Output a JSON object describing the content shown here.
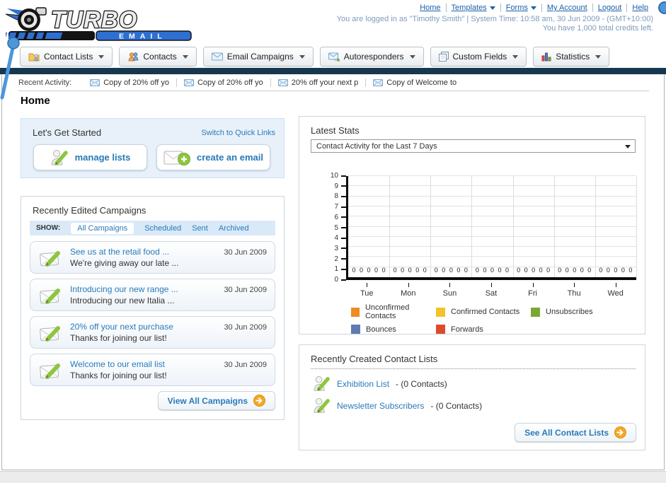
{
  "colors": {
    "accent_blue": "#2a7ab9",
    "navy_bar": "#17374f",
    "panel_blue_bg": "#e8f1fa",
    "arrow_orange": "#f5a623"
  },
  "header": {
    "logo": {
      "line1": "TURBO",
      "line2": "EMAIL"
    },
    "links": [
      {
        "label": "Home",
        "dropdown": false
      },
      {
        "label": "Templates",
        "dropdown": true
      },
      {
        "label": "Forms",
        "dropdown": true
      },
      {
        "label": "My Account",
        "dropdown": false
      },
      {
        "label": "Logout",
        "dropdown": false
      },
      {
        "label": "Help",
        "dropdown": false
      }
    ],
    "login_text": "You are logged in as \"Timothy Smith\" | System Time: 10:58 am, 30 Jun 2009 - (GMT+10:00)",
    "credits_text": "You have 1,000 total credits left."
  },
  "nav": {
    "tabs": [
      {
        "label": "Contact Lists"
      },
      {
        "label": "Contacts"
      },
      {
        "label": "Email Campaigns"
      },
      {
        "label": "Autoresponders"
      },
      {
        "label": "Custom Fields"
      },
      {
        "label": "Statistics"
      }
    ]
  },
  "recent_activity": {
    "label": "Recent Activity:",
    "items": [
      {
        "text": "Copy of 20% off yo"
      },
      {
        "text": "Copy of 20% off yo"
      },
      {
        "text": "20% off your next p"
      },
      {
        "text": "Copy of Welcome to"
      }
    ]
  },
  "home": {
    "title": "Home"
  },
  "get_started": {
    "title": "Let's Get Started",
    "switch_link": "Switch to Quick Links",
    "manage_lists_label": "manage lists",
    "create_email_label": "create an email"
  },
  "campaigns": {
    "title": "Recently Edited Campaigns",
    "show_label": "SHOW:",
    "filters": [
      {
        "label": "All Campaigns",
        "active": true
      },
      {
        "label": "Scheduled",
        "active": false
      },
      {
        "label": "Sent",
        "active": false
      },
      {
        "label": "Archived",
        "active": false
      }
    ],
    "items": [
      {
        "title": "See us at the retail food ...",
        "subtitle": "We're giving away our late ...",
        "date": "30 Jun 2009"
      },
      {
        "title": "Introducing our new range ...",
        "subtitle": "Introducing our new Italia ...",
        "date": "30 Jun 2009"
      },
      {
        "title": "20% off your next purchase",
        "subtitle": "Thanks for joining our list!",
        "date": "30 Jun 2009"
      },
      {
        "title": "Welcome to our email list",
        "subtitle": "Thanks for joining our list!",
        "date": "30 Jun 2009"
      }
    ],
    "view_all_label": "View All Campaigns"
  },
  "stats": {
    "title": "Latest Stats",
    "selected_period": "Contact Activity for the Last 7 Days"
  },
  "chart_data": {
    "type": "bar",
    "title": "Contact Activity for the Last 7 Days",
    "categories": [
      "Tue",
      "Mon",
      "Sun",
      "Sat",
      "Fri",
      "Thu",
      "Wed"
    ],
    "series": [
      {
        "name": "Unconfirmed Contacts",
        "color": "#EF8B23",
        "values": [
          0,
          0,
          0,
          0,
          0,
          0,
          0
        ]
      },
      {
        "name": "Confirmed Contacts",
        "color": "#F4C32B",
        "values": [
          0,
          0,
          0,
          0,
          0,
          0,
          0
        ]
      },
      {
        "name": "Unsubscribes",
        "color": "#7CA733",
        "values": [
          0,
          0,
          0,
          0,
          0,
          0,
          0
        ]
      },
      {
        "name": "Bounces",
        "color": "#5F7BB0",
        "values": [
          0,
          0,
          0,
          0,
          0,
          0,
          0
        ]
      },
      {
        "name": "Forwards",
        "color": "#DF4A2B",
        "values": [
          0,
          0,
          0,
          0,
          0,
          0,
          0
        ]
      }
    ],
    "ylim": [
      0,
      10
    ],
    "y_tick_step": 1,
    "grid": true,
    "value_labels_shown": true,
    "legend_position": "bottom"
  },
  "contact_lists": {
    "title": "Recently Created Contact Lists",
    "items": [
      {
        "name": "Exhibition List",
        "suffix": "- (0 Contacts)"
      },
      {
        "name": "Newsletter Subscribers",
        "suffix": "- (0 Contacts)"
      }
    ],
    "see_all_label": "See All Contact Lists"
  }
}
